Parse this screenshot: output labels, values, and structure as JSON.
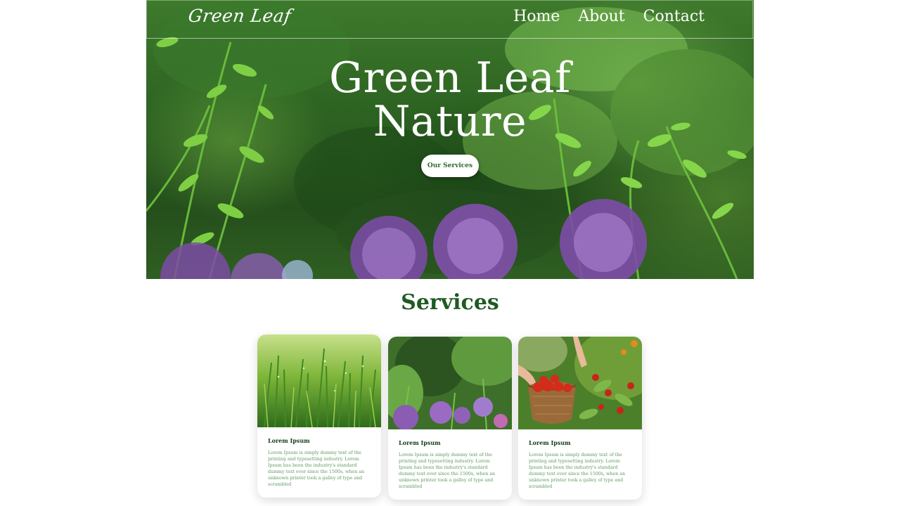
{
  "header": {
    "logo": "Green Leaf",
    "nav": [
      "Home",
      "About",
      "Contact"
    ]
  },
  "hero": {
    "title_line1": "Green Leaf",
    "title_line2": "Nature",
    "button": "Our Services"
  },
  "services": {
    "title": "Services",
    "cards": [
      {
        "heading": "Lorem Ipsum",
        "text": "Lorem Ipsum is simply dummy text of the printing and typesetting industry. Lorem Ipsum has been the industry's standard dummy text ever since the 1500s, when an unknown printer took a galley of type and scrambled",
        "image": "grass-photo"
      },
      {
        "heading": "Lorem Ipsum",
        "text": "Lorem Ipsum is simply dummy text of the printing and typesetting industry. Lorem Ipsum has been the industry's standard dummy text ever since the 1500s, when an unknown printer took a galley of type and scrambled",
        "image": "allium-garden-photo"
      },
      {
        "heading": "Lorem Ipsum",
        "text": "Lorem Ipsum is simply dummy text of the printing and typesetting industry. Lorem Ipsum has been the industry's standard dummy text ever since the 1500s, when an unknown printer took a galley of type and scrambled",
        "image": "tomato-harvest-photo"
      }
    ]
  },
  "colors": {
    "brand_green": "#1f5a22",
    "button_text": "#2e6b2a",
    "card_text": "#5d9a5e",
    "allium_purple": "#8a5bb0"
  }
}
